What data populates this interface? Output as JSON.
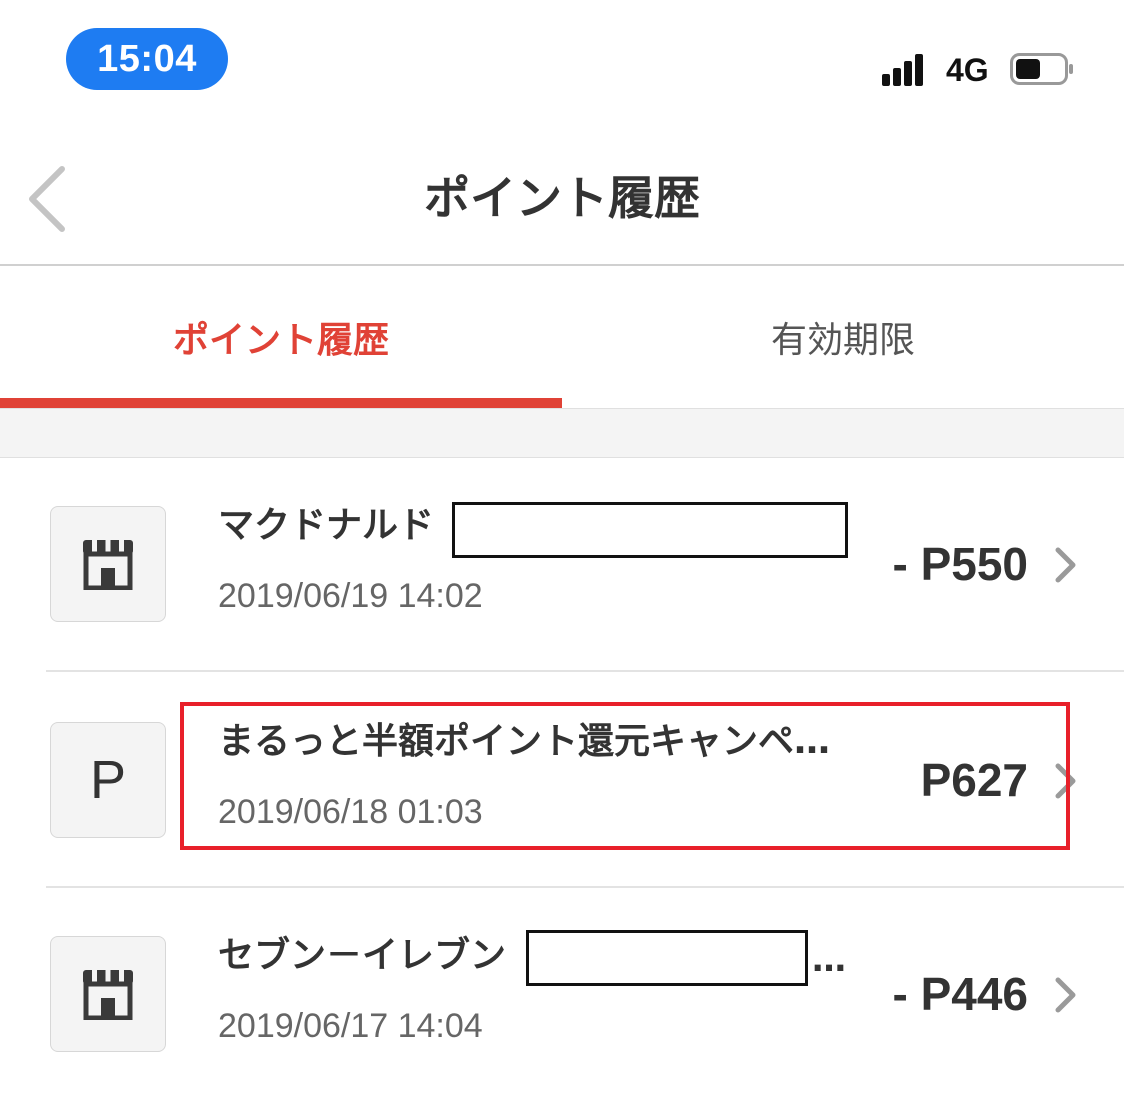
{
  "status_bar": {
    "time": "15:04",
    "network": "4G",
    "signal_icon": "signal-bars-icon",
    "battery_icon": "battery-icon",
    "pill_color": "#1e7cf2"
  },
  "nav": {
    "title": "ポイント履歴",
    "back_icon": "chevron-left-icon"
  },
  "tabs": [
    {
      "label": "ポイント履歴",
      "active": true
    },
    {
      "label": "有効期限",
      "active": false
    }
  ],
  "accent_color": "#e04236",
  "highlight_color": "#e8202a",
  "history": [
    {
      "title": "マクドナルド",
      "date": "2019/06/19 14:02",
      "amount": "- P550",
      "icon": "store-icon",
      "redacted": true
    },
    {
      "title": "まるっと半額ポイント還元キャンペ…",
      "date": "2019/06/18 01:03",
      "amount": "P627",
      "icon": "points-icon",
      "icon_glyph": "P",
      "highlighted": true
    },
    {
      "title": "セブン－イレブン",
      "title_suffix": "…",
      "date": "2019/06/17 14:04",
      "amount": "- P446",
      "icon": "store-icon",
      "redacted": true
    }
  ]
}
